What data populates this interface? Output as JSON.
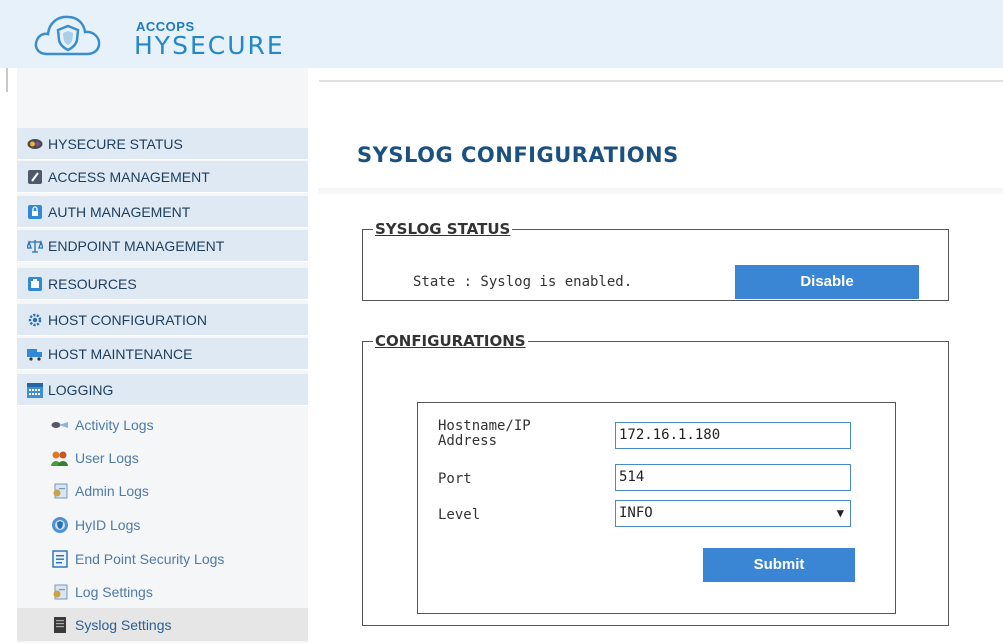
{
  "brand": {
    "company": "ACCOPS",
    "product": "HYSECURE"
  },
  "sidebar": {
    "items": [
      {
        "label": "HYSECURE STATUS",
        "icon": "status-eye-icon"
      },
      {
        "label": "ACCESS MANAGEMENT",
        "icon": "shield-icon"
      },
      {
        "label": "AUTH MANAGEMENT",
        "icon": "lock-icon"
      },
      {
        "label": "ENDPOINT MANAGEMENT",
        "icon": "scale-icon"
      },
      {
        "label": "RESOURCES",
        "icon": "resources-icon"
      },
      {
        "label": "HOST CONFIGURATION",
        "icon": "gear-icon"
      },
      {
        "label": "HOST MAINTENANCE",
        "icon": "truck-icon"
      },
      {
        "label": "LOGGING",
        "icon": "calendar-icon"
      }
    ],
    "subitems": [
      {
        "label": "Activity Logs",
        "icon": "activity-icon"
      },
      {
        "label": "User Logs",
        "icon": "users-icon"
      },
      {
        "label": "Admin Logs",
        "icon": "admin-logs-icon"
      },
      {
        "label": "HyID Logs",
        "icon": "hyid-icon"
      },
      {
        "label": "End Point Security Logs",
        "icon": "endpoint-logs-icon"
      },
      {
        "label": "Log Settings",
        "icon": "log-settings-icon"
      },
      {
        "label": "Syslog Settings",
        "icon": "syslog-icon",
        "active": true
      }
    ]
  },
  "main": {
    "title": "SYSLOG CONFIGURATIONS",
    "status_section": {
      "legend": "SYSLOG STATUS",
      "state_text": "State : Syslog is enabled.",
      "disable_label": "Disable"
    },
    "config_section": {
      "legend": "CONFIGURATIONS",
      "hostname_label": "Hostname/IP Address",
      "hostname_value": "172.16.1.180",
      "port_label": "Port",
      "port_value": "514",
      "level_label": "Level",
      "level_value": "INFO",
      "submit_label": "Submit"
    }
  },
  "colors": {
    "header_bg": "#e6f1f9",
    "brand_blue": "#1d7cba",
    "menu_bg": "#dfe9f3",
    "title_blue": "#1a5180",
    "button_blue": "#3b86d4",
    "submenu_text": "#4f7ba6"
  }
}
